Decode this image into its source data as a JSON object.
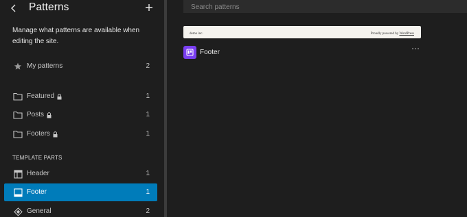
{
  "sidebar": {
    "title": "Patterns",
    "description": "Manage what patterns are available when editing the site.",
    "my_patterns": {
      "label": "My patterns",
      "count": "2"
    },
    "categories": [
      {
        "label": "Featured",
        "count": "1"
      },
      {
        "label": "Posts",
        "count": "1"
      },
      {
        "label": "Footers",
        "count": "1"
      }
    ],
    "template_parts_heading": "TEMPLATE PARTS",
    "template_parts": [
      {
        "label": "Header",
        "count": "1"
      },
      {
        "label": "Footer",
        "count": "1"
      },
      {
        "label": "General",
        "count": "2"
      }
    ]
  },
  "main": {
    "search_placeholder": "Search patterns",
    "preview": {
      "left_text": "demo inc.",
      "right_prefix": "Proudly powered by",
      "right_link": "WordPress"
    },
    "card_title": "Footer",
    "more_label": "⋯"
  },
  "colors": {
    "background": "#1e1e1e",
    "active": "#007cba",
    "pattern_icon": "#7a3ff2"
  }
}
